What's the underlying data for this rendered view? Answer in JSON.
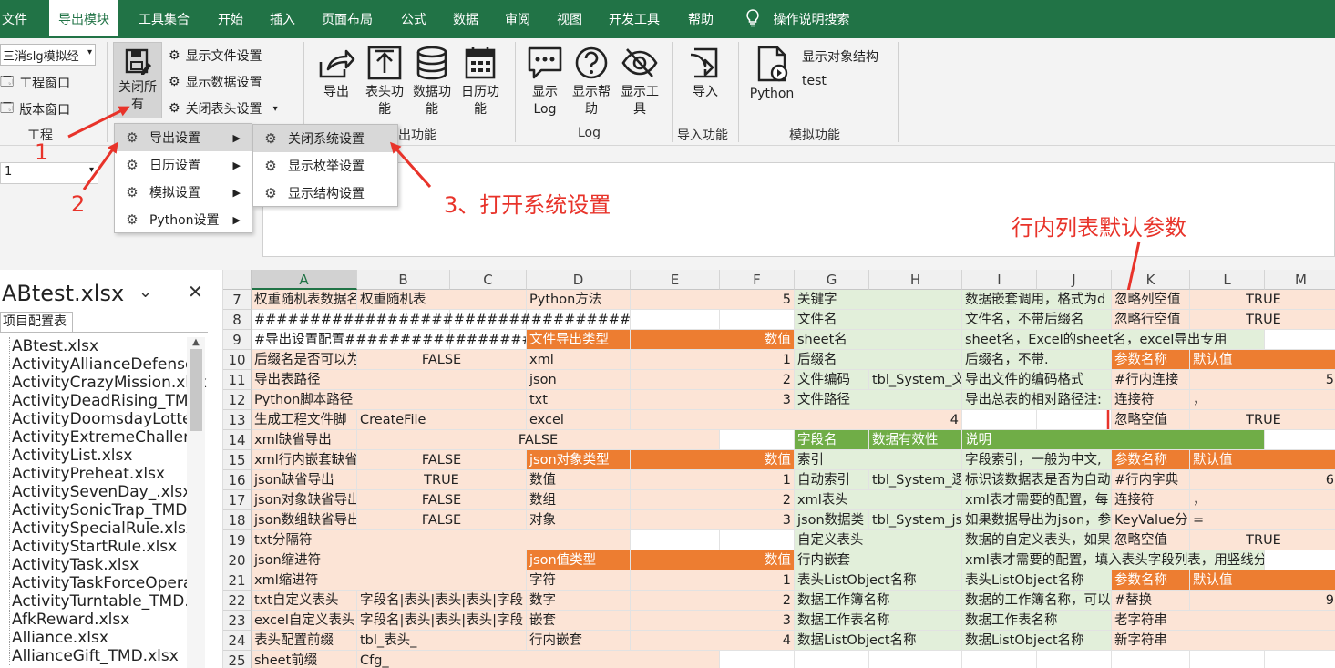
{
  "tabs": [
    "文件",
    "导出模块",
    "工具集合",
    "开始",
    "插入",
    "页面布局",
    "公式",
    "数据",
    "审阅",
    "视图",
    "开发工具",
    "帮助",
    "操作说明搜索"
  ],
  "ribbon": {
    "dropdown_value": "三消slg模拟经",
    "project_window": "工程窗口",
    "version_window": "版本窗口",
    "close_all": "关闭所有",
    "show_file": "显示文件设置",
    "show_data": "显示数据设置",
    "close_header": "关闭表头设置",
    "export": "导出",
    "header_func": "表头功能",
    "data_func": "数据功能",
    "calendar_func": "日历功能",
    "show_log": "显示Log",
    "show_help": "显示帮助",
    "show_tools": "显示工具",
    "import": "导入",
    "python": "Python",
    "show_struct": "显示对象结构",
    "test": "test",
    "groups": [
      "工程",
      "出功能",
      "Log",
      "导入功能",
      "模拟功能"
    ]
  },
  "menu": {
    "items": [
      "导出设置",
      "日历设置",
      "模拟设置",
      "Python设置"
    ],
    "sub": [
      "关闭系统设置",
      "显示枚举设置",
      "显示结构设置"
    ]
  },
  "annotations": {
    "a1": "1",
    "a2": "2",
    "a3": "3、打开系统设置",
    "a4": "行内列表默认参数"
  },
  "namebox": "1",
  "pane": {
    "title": "ABtest.xlsx",
    "tab": "项目配置表",
    "files": [
      "ABtest.xlsx",
      "ActivityAllianceDefense",
      "ActivityCrazyMission.xlsx",
      "ActivityDeadRising_TMD.",
      "ActivityDoomsdayLotter",
      "ActivityExtremeChalleng",
      "ActivityList.xlsx",
      "ActivityPreheat.xlsx",
      "ActivitySevenDay_.xlsx",
      "ActivitySonicTrap_TMD.x",
      "ActivitySpecialRule.xlsx",
      "ActivityStartRule.xlsx",
      "ActivityTask.xlsx",
      "ActivityTaskForceOpera",
      "ActivityTurntable_TMD.x",
      "AfkReward.xlsx",
      "Alliance.xlsx",
      "AllianceGift_TMD.xlsx"
    ]
  },
  "cols": [
    "A",
    "B",
    "C",
    "D",
    "E",
    "F",
    "G",
    "H",
    "I",
    "J",
    "K",
    "L",
    "M"
  ],
  "rows": [
    "7",
    "8",
    "9",
    "10",
    "11",
    "12",
    "13",
    "14",
    "15",
    "16",
    "17",
    "18",
    "19",
    "20",
    "21",
    "22",
    "23",
    "24",
    "25"
  ],
  "cells": [
    [
      "权重随机表数据名",
      "权重随机表",
      "",
      "Python方法",
      "5",
      "",
      "关键字",
      "",
      "数据嵌套调用，格式为d",
      "",
      "忽略列空值",
      "TRUE",
      ""
    ],
    [
      "####################################",
      "",
      "",
      "",
      "",
      "",
      "文件名",
      "",
      "文件名，不带后缀名",
      "",
      "忽略行空值",
      "TRUE",
      ""
    ],
    [
      "#导出设置配置####################",
      "",
      "",
      "文件导出类型",
      "数值",
      "",
      "sheet名",
      "",
      "sheet名，Excel的sheet名，excel导出专用",
      "",
      "",
      "",
      ""
    ],
    [
      "后缀名是否可以为",
      "FALSE",
      "",
      "xml",
      "1",
      "",
      "后缀名",
      "",
      "后缀名，不带.",
      "",
      "参数名称",
      "默认值",
      ""
    ],
    [
      "导出表路径",
      "",
      "",
      "json",
      "2",
      "",
      "文件编码",
      "tbl_System_文",
      "导出文件的编码格式",
      "",
      "#行内连接",
      "5",
      ""
    ],
    [
      "Python脚本路径",
      "",
      "",
      "txt",
      "3",
      "",
      "文件路径",
      "",
      "导出总表的相对路径注:",
      "",
      "连接符",
      "，",
      ""
    ],
    [
      "生成工程文件脚",
      "CreateFile",
      "",
      "excel",
      "4",
      "",
      "",
      "",
      "",
      "",
      "忽略空值",
      "TRUE",
      ""
    ],
    [
      "xml缺省导出",
      "FALSE",
      "",
      "",
      "",
      "",
      "字段名",
      "数据有效性",
      "说明",
      "",
      "",
      "",
      ""
    ],
    [
      "xml行内嵌套缺省",
      "FALSE",
      "",
      "json对象类型",
      "数值",
      "",
      "索引",
      "",
      "字段索引，一般为中文,",
      "",
      "参数名称",
      "默认值",
      ""
    ],
    [
      "json缺省导出",
      "TRUE",
      "",
      "数值",
      "1",
      "",
      "自动索引",
      "tbl_System_逻",
      "标识该数据表是否为自动",
      "",
      "#行内字典",
      "6",
      ""
    ],
    [
      "json对象缺省导出",
      "FALSE",
      "",
      "数组",
      "2",
      "",
      "xml表头",
      "",
      "xml表才需要的配置，每",
      "",
      "连接符",
      "，",
      ""
    ],
    [
      "json数组缺省导出",
      "FALSE",
      "",
      "对象",
      "3",
      "",
      "json数据类",
      "tbl_System_js",
      "如果数据导出为json，参",
      "",
      "KeyValue分",
      "=",
      ""
    ],
    [
      "txt分隔符",
      "",
      "",
      "",
      "",
      "",
      "自定义表头",
      "",
      "数据的自定义表头，如果",
      "",
      "忽略空值",
      "TRUE",
      ""
    ],
    [
      "json缩进符",
      "",
      "",
      "json值类型",
      "数值",
      "",
      "行内嵌套",
      "",
      "xml表才需要的配置，填入表头字段列表，用竖线分开，格式为",
      "",
      "",
      "",
      ""
    ],
    [
      "xml缩进符",
      "",
      "",
      "字符",
      "1",
      "",
      "表头ListObject名称",
      "",
      "表头ListObject名称",
      "",
      "参数名称",
      "默认值",
      ""
    ],
    [
      "txt自定义表头",
      "字段名|表头|表头|表头|字段",
      "",
      "数字",
      "2",
      "",
      "数据工作簿名称",
      "",
      "数据的工作簿名称，可以",
      "",
      "#替换",
      "9",
      ""
    ],
    [
      "excel自定义表头",
      "字段名|表头|表头|表头|字段",
      "",
      "嵌套",
      "3",
      "",
      "数据工作表名称",
      "",
      "数据工作表名称",
      "",
      "老字符串",
      "",
      ""
    ],
    [
      "表头配置前缀",
      "tbl_表头_",
      "",
      "行内嵌套",
      "4",
      "",
      "数据ListObject名称",
      "",
      "数据ListObject名称",
      "",
      "新字符串",
      "",
      ""
    ],
    [
      "sheet前缀",
      "Cfg_",
      "",
      "",
      "",
      "",
      "",
      "",
      "",
      "",
      "",
      "",
      ""
    ]
  ]
}
